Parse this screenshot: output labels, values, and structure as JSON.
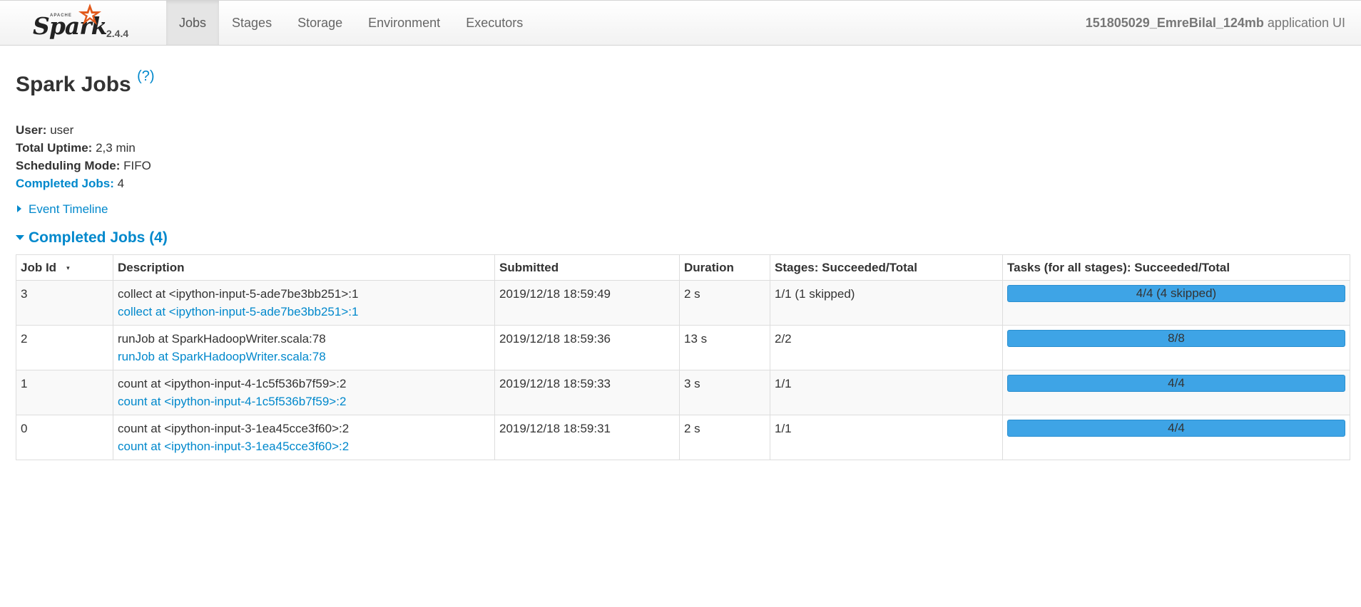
{
  "brand": {
    "apache": "APACHE",
    "name": "Spark",
    "version": "2.4.4"
  },
  "nav": [
    {
      "label": "Jobs",
      "active": true
    },
    {
      "label": "Stages"
    },
    {
      "label": "Storage"
    },
    {
      "label": "Environment"
    },
    {
      "label": "Executors"
    }
  ],
  "app": {
    "name": "151805029_EmreBilal_124mb",
    "suffix": " application UI"
  },
  "page": {
    "title": "Spark Jobs",
    "help": "(?)"
  },
  "info": {
    "user_label": "User:",
    "user_value": " user",
    "uptime_label": "Total Uptime:",
    "uptime_value": " 2,3 min",
    "mode_label": "Scheduling Mode:",
    "mode_value": " FIFO",
    "completed_label": "Completed Jobs:",
    "completed_value": " 4"
  },
  "timeline_label": "Event Timeline",
  "completed_section": "Completed Jobs (4)",
  "table": {
    "headers": [
      "Job Id",
      "Description",
      "Submitted",
      "Duration",
      "Stages: Succeeded/Total",
      "Tasks (for all stages): Succeeded/Total"
    ],
    "sort_indicator": "▾",
    "rows": [
      {
        "id": "3",
        "desc": "collect at <ipython-input-5-ade7be3bb251>:1",
        "link": "collect at <ipython-input-5-ade7be3bb251>:1",
        "submitted": "2019/12/18 18:59:49",
        "duration": "2 s",
        "stages": "1/1 (1 skipped)",
        "tasks": "4/4 (4 skipped)",
        "task_progress": 1.0
      },
      {
        "id": "2",
        "desc": "runJob at SparkHadoopWriter.scala:78",
        "link": "runJob at SparkHadoopWriter.scala:78",
        "submitted": "2019/12/18 18:59:36",
        "duration": "13 s",
        "stages": "2/2",
        "tasks": "8/8",
        "task_progress": 1.0
      },
      {
        "id": "1",
        "desc": "count at <ipython-input-4-1c5f536b7f59>:2",
        "link": "count at <ipython-input-4-1c5f536b7f59>:2",
        "submitted": "2019/12/18 18:59:33",
        "duration": "3 s",
        "stages": "1/1",
        "tasks": "4/4",
        "task_progress": 1.0
      },
      {
        "id": "0",
        "desc": "count at <ipython-input-3-1ea45cce3f60>:2",
        "link": "count at <ipython-input-3-1ea45cce3f60>:2",
        "submitted": "2019/12/18 18:59:31",
        "duration": "2 s",
        "stages": "1/1",
        "tasks": "4/4",
        "task_progress": 1.0
      }
    ]
  },
  "colors": {
    "link": "#0088cc",
    "progress": "#3ea4e6"
  }
}
